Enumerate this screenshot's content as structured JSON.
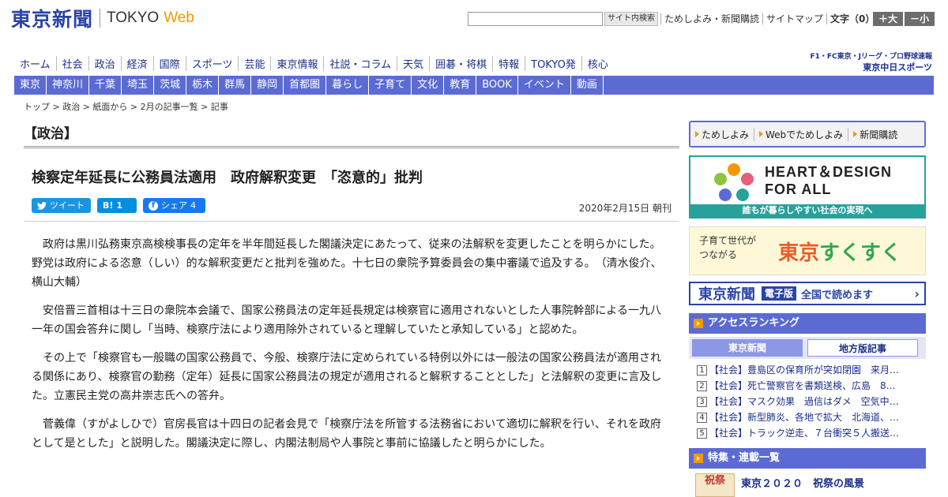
{
  "header": {
    "logo_jp": "東京新聞",
    "logo_en": "TOKYO",
    "logo_web": "Web",
    "search_button": "サイト内検索",
    "util_links": [
      "ためしよみ・新聞購読",
      "サイトマップ"
    ],
    "font_size_label": "文字（0）",
    "font_larger": "＋大",
    "font_smaller": "－小"
  },
  "main_nav": [
    "ホーム",
    "社会",
    "政治",
    "経済",
    "国際",
    "スポーツ",
    "芸能",
    "東京情報",
    "社説・コラム",
    "天気",
    "囲碁・将棋",
    "特報",
    "TOKYO発",
    "核心"
  ],
  "sports_banner": {
    "top": "F1・FC東京・Jリーグ・プロ野球速報",
    "bottom": "東京中日スポーツ"
  },
  "sub_nav": [
    "東京",
    "神奈川",
    "千葉",
    "埼玉",
    "茨城",
    "栃木",
    "群馬",
    "静岡",
    "首都圏",
    "暮らし",
    "子育て",
    "文化",
    "教育",
    "BOOK",
    "イベント",
    "動画"
  ],
  "breadcrumb": [
    "トップ",
    "政治",
    "紙面から",
    "2月の記事一覧",
    "記事"
  ],
  "article": {
    "category": "【政治】",
    "headline": "検察定年延長に公務員法適用　政府解釈変更　「恣意的」批判",
    "share": {
      "tweet_label": "ツイート",
      "hatena_label": "B!",
      "hatena_count": "1",
      "facebook_label": "シェア",
      "facebook_count": "4"
    },
    "date": "2020年2月15日 朝刊",
    "paragraphs": [
      "政府は黒川弘務東京高検検事長の定年を半年間延長した閣議決定にあたって、従来の法解釈を変更したことを明らかにした。野党は政府による恣意（しい）的な解釈変更だと批判を強めた。十七日の衆院予算委員会の集中審議で追及する。　（清水俊介、横山大輔）",
      "安倍晋三首相は十三日の衆院本会議で、国家公務員法の定年延長規定は検察官に適用されないとした人事院幹部による一九八一年の国会答弁に関し「当時、検察庁法により適用除外されていると理解していたと承知している」と認めた。",
      "その上で「検察官も一般職の国家公務員で、今般、検察庁法に定められている特例以外には一般法の国家公務員法が適用される関係にあり、検察官の勤務（定年）延長に国家公務員法の規定が適用されると解釈することとした」と法解釈の変更に言及した。立憲民主党の高井崇志氏への答弁。",
      "菅義偉（すがよしひで）官房長官は十四日の記者会見で「検察庁法を所管する法務省において適切に解釈を行い、それを政府として是とした」と説明した。閣議決定に際し、内閣法制局や人事院と事前に協議したと明らかにした。"
    ]
  },
  "sidebar": {
    "links": [
      "ためしよみ",
      "Webでためしよみ",
      "新聞購読"
    ],
    "heart_design": {
      "title_line1": "HEART＆DESIGN",
      "title_line2": "FOR ALL",
      "caption": "誰もが暮らしやすい社会の実現へ"
    },
    "sukusuku": {
      "sub_line1": "子育て世代が",
      "sub_line2": "つながる",
      "city": "東京",
      "main": "すくすく"
    },
    "e_paper": {
      "logo": "東京新聞",
      "badge": "電子版",
      "text": "全国で読めます"
    },
    "ranking": {
      "title": "アクセスランキング",
      "tabs": [
        "東京新聞",
        "地方版記事"
      ],
      "items": [
        {
          "num": "1",
          "text": "【社会】豊島区の保育所が突如閉園　来月…"
        },
        {
          "num": "2",
          "text": "【社会】死亡警察官を書類送検、広島　8…"
        },
        {
          "num": "3",
          "text": "【社会】マスク効果　過信はダメ　空気中…"
        },
        {
          "num": "4",
          "text": "【社会】新型肺炎、各地で拡大　北海道、…"
        },
        {
          "num": "5",
          "text": "【社会】トラック逆走、７台衝突５人搬送…"
        }
      ]
    },
    "features": {
      "title": "特集・連載一覧",
      "item_thumb": "祝祭",
      "item_title": "東京２０２０　祝祭の風景"
    }
  },
  "colors": {
    "brand_blue": "#2a44a8",
    "nav_blue": "#5c6bd3",
    "accent_orange": "#f39800",
    "hd_teal": "#27a29a"
  }
}
